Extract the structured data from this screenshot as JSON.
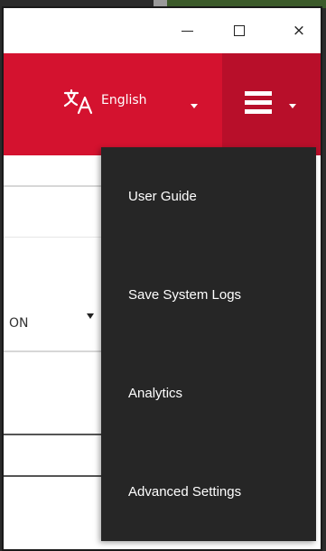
{
  "window": {
    "controls": {
      "minimize": "minimize",
      "maximize": "maximize",
      "close": "×"
    }
  },
  "header": {
    "language": {
      "icon": "translate-icon",
      "label": "English"
    },
    "menu_icon": "hamburger-menu-icon"
  },
  "content": {
    "select_value": "ON"
  },
  "dropdown": {
    "items": [
      {
        "label": "User Guide"
      },
      {
        "label": "Save System Logs"
      },
      {
        "label": "Analytics"
      },
      {
        "label": "Advanced Settings"
      }
    ]
  },
  "colors": {
    "header_red": "#d4122f",
    "menu_toggle_red": "#b80f2a",
    "dropdown_bg": "#262626"
  }
}
